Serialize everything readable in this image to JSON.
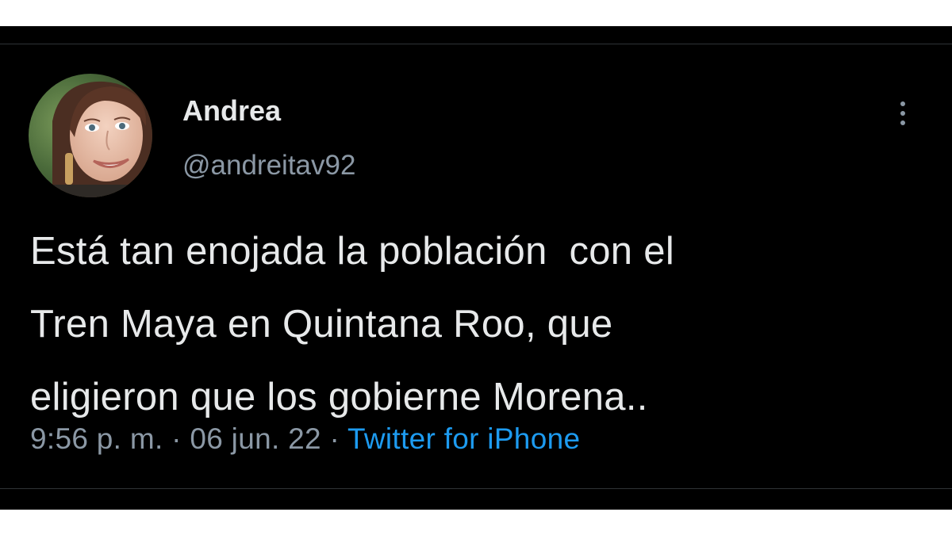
{
  "tweet": {
    "author": {
      "display_name": "Andrea",
      "handle": "@andreitav92",
      "avatar": "profile-photo"
    },
    "text": "Está tan enojada la población  con el\nTren Maya en Quintana Roo, que\neligieron que los gobierne Morena..",
    "time": "9:56 p. m.",
    "separator": "·",
    "date": "06 jun. 22",
    "source": "Twitter for iPhone",
    "more_icon": "more-vertical-icon"
  },
  "colors": {
    "background": "#000000",
    "text": "#e7e9ea",
    "secondary": "#8b98a5",
    "link": "#1d9bf0"
  }
}
